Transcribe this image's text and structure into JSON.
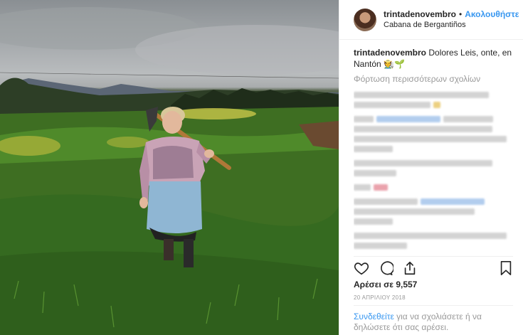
{
  "post": {
    "username": "trintadenovembro",
    "separator": "•",
    "follow_label": "Ακολουθήστε",
    "location": "Cabana de Bergantiños",
    "caption_text": "Dolores Leis, onte, en Nantón",
    "caption_emoji": "🧑‍🌾🌱",
    "load_more_label": "Φόρτωση περισσότερων σχολίων",
    "likes_label": "Αρέσει σε 9,557",
    "date_label": "20 ΑΠΡΙΛΙΟΥ 2018",
    "login_link": "Συνδεθείτε",
    "login_rest": " για να σχολιάσετε ή να δηλώσετε ότι σας αρέσει."
  },
  "icons": {
    "like": "heart-icon",
    "comment": "comment-icon",
    "share": "share-icon",
    "save": "bookmark-icon"
  },
  "colors": {
    "link_blue": "#3897f0",
    "muted": "#999999",
    "text": "#262626"
  }
}
